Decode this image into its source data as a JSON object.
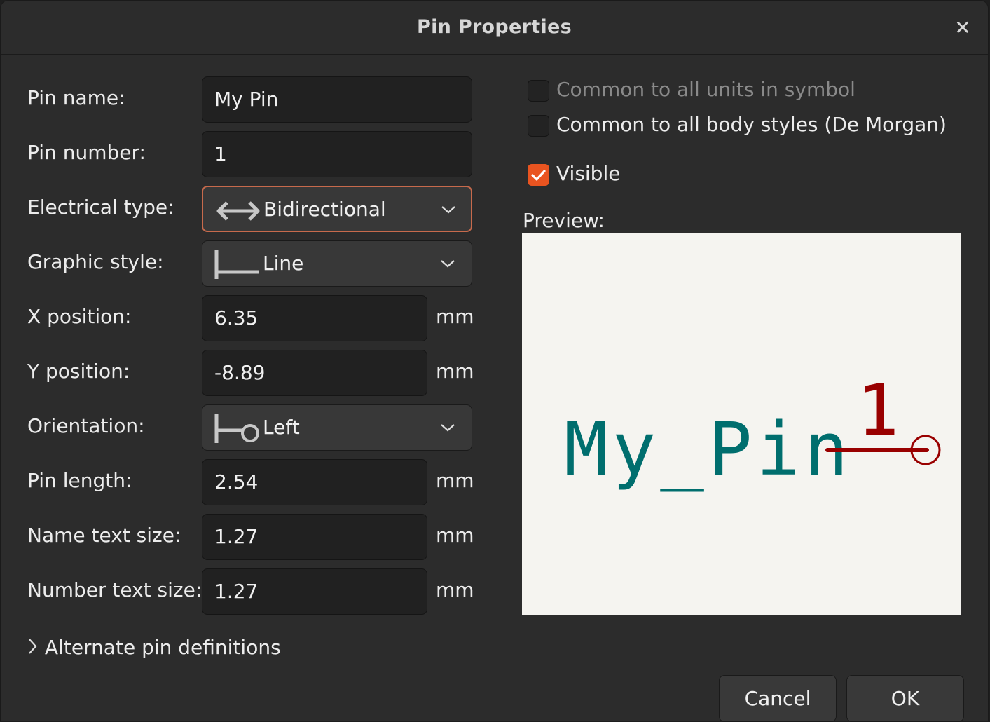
{
  "dialog": {
    "title": "Pin Properties"
  },
  "form": {
    "pin_name_label": "Pin name:",
    "pin_name_value": "My Pin",
    "pin_number_label": "Pin number:",
    "pin_number_value": "1",
    "electrical_type_label": "Electrical type:",
    "electrical_type_value": "Bidirectional",
    "electrical_type_icon": "bidirectional-arrow-icon",
    "graphic_style_label": "Graphic style:",
    "graphic_style_value": "Line",
    "graphic_style_icon": "line-style-icon",
    "x_position_label": "X position:",
    "x_position_value": "6.35",
    "y_position_label": "Y position:",
    "y_position_value": "-8.89",
    "orientation_label": "Orientation:",
    "orientation_value": "Left",
    "orientation_icon": "orientation-left-icon",
    "pin_length_label": "Pin length:",
    "pin_length_value": "2.54",
    "name_text_size_label": "Name text size:",
    "name_text_size_value": "1.27",
    "number_text_size_label": "Number text size:",
    "number_text_size_value": "1.27",
    "unit": "mm"
  },
  "options": {
    "common_units_label": "Common to all units in symbol",
    "common_units_checked": false,
    "common_units_enabled": false,
    "common_body_label": "Common to all body styles (De Morgan)",
    "common_body_checked": false,
    "visible_label": "Visible",
    "visible_checked": true
  },
  "preview": {
    "label": "Preview:",
    "pin_name_text": "My_Pin",
    "pin_number_text": "1"
  },
  "alternates": {
    "label": "Alternate pin definitions"
  },
  "buttons": {
    "cancel": "Cancel",
    "ok": "OK"
  },
  "colors": {
    "accent": "#e95420",
    "focus_border": "#c76a4c",
    "preview_name": "#006e6e",
    "preview_pin": "#990000",
    "preview_bg": "#f5f4f0"
  }
}
